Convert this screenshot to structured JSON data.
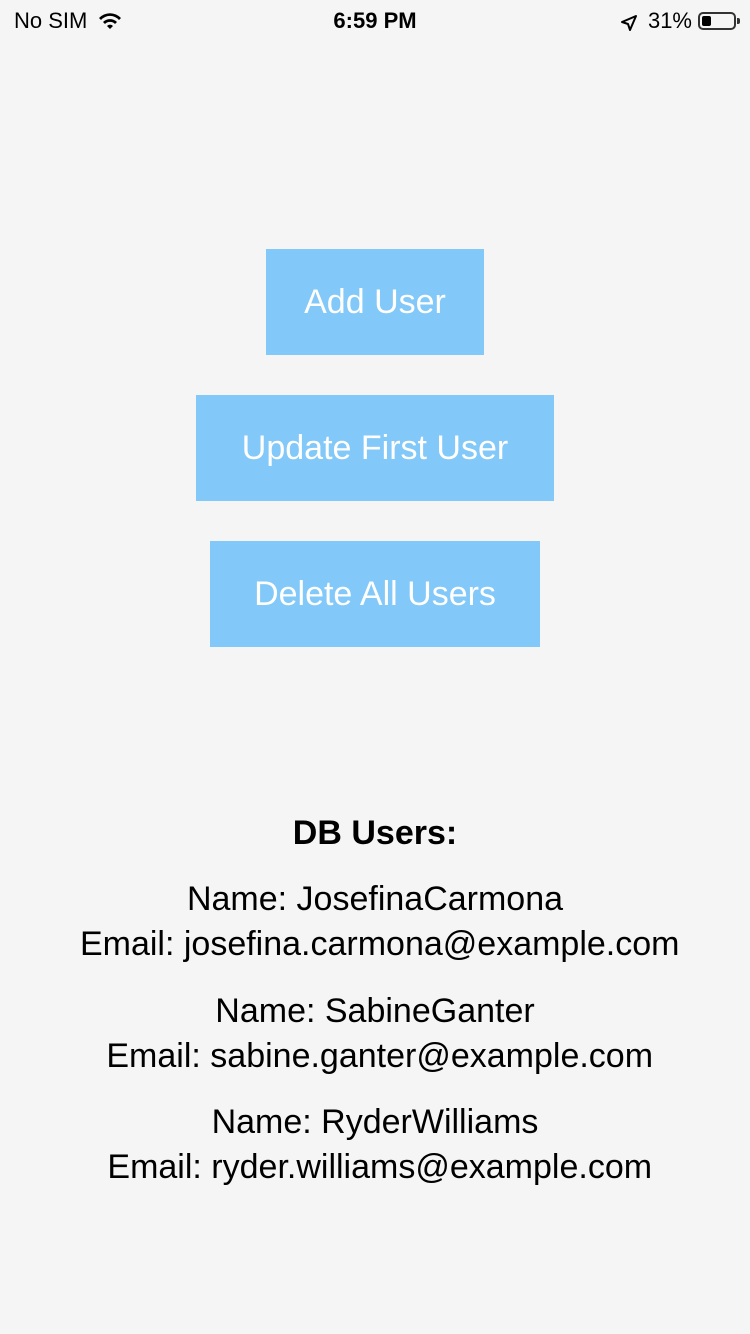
{
  "status_bar": {
    "carrier": "No SIM",
    "time": "6:59 PM",
    "battery_percent": "31%",
    "battery_level": 0.31,
    "icons": [
      "wifi-icon",
      "location-icon",
      "battery-icon"
    ]
  },
  "buttons": {
    "add_user": "Add User",
    "update_first_user": "Update First User",
    "delete_all_users": "Delete All Users"
  },
  "db_title": "DB Users:",
  "users": [
    {
      "name_line": "Name: JosefinaCarmona",
      "email_line": " Email: josefina.carmona@example.com"
    },
    {
      "name_line": "Name: SabineGanter",
      "email_line": " Email: sabine.ganter@example.com"
    },
    {
      "name_line": "Name: RyderWilliams",
      "email_line": " Email: ryder.williams@example.com"
    }
  ],
  "colors": {
    "button_bg": "#82c8f8",
    "button_text": "#ffffff",
    "background": "#f5f5f5"
  }
}
